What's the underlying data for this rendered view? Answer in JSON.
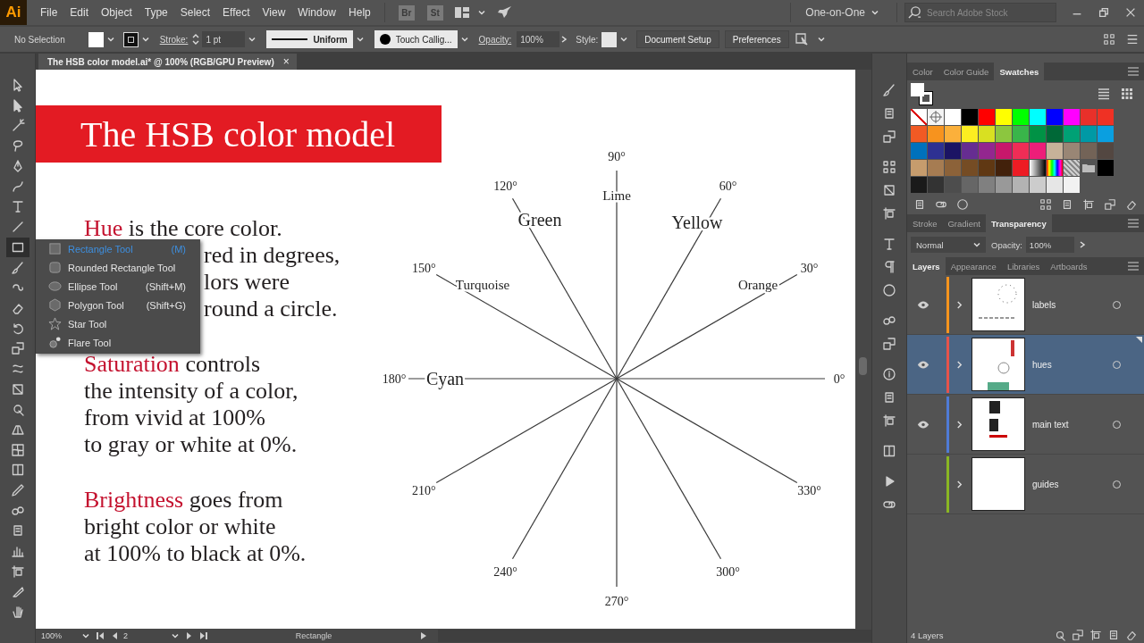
{
  "menu_bar": {
    "logo": "Ai",
    "items": [
      "File",
      "Edit",
      "Object",
      "Type",
      "Select",
      "Effect",
      "View",
      "Window",
      "Help"
    ],
    "bridge": "Br",
    "stock": "St",
    "workspace": "One-on-One",
    "search": {
      "placeholder": "Search Adobe Stock"
    }
  },
  "control_bar": {
    "selection": "No Selection",
    "stroke_label": "Stroke:",
    "stroke_weight": "1 pt",
    "profile": "Uniform",
    "brush": "Touch Callig...",
    "opacity_label": "Opacity:",
    "opacity": "100%",
    "style_label": "Style:",
    "buttons": [
      "Document Setup",
      "Preferences"
    ]
  },
  "document_tab": {
    "title": "The HSB color model.ai* @ 100% (RGB/GPU Preview)",
    "close": "×"
  },
  "tools": [
    {
      "kind": "arrow",
      "selected": false
    },
    {
      "kind": "direct",
      "selected": false
    },
    {
      "kind": "wand",
      "selected": false
    },
    {
      "kind": "lasso",
      "selected": false
    },
    {
      "kind": "pen",
      "selected": false
    },
    {
      "kind": "curve",
      "selected": false
    },
    {
      "kind": "type",
      "selected": false
    },
    {
      "kind": "line",
      "selected": false
    },
    {
      "kind": "rect",
      "selected": true
    },
    {
      "kind": "brush",
      "selected": false
    },
    {
      "kind": "shaper",
      "selected": false
    },
    {
      "kind": "eraser",
      "selected": false
    },
    {
      "kind": "rotate",
      "selected": false
    },
    {
      "kind": "scale",
      "selected": false
    },
    {
      "kind": "warp",
      "selected": false
    },
    {
      "kind": "transform",
      "selected": false
    },
    {
      "kind": "builder",
      "selected": false
    },
    {
      "kind": "perspective",
      "selected": false
    },
    {
      "kind": "mesh",
      "selected": false
    },
    {
      "kind": "gradient",
      "selected": false
    },
    {
      "kind": "eyedropper",
      "selected": false
    },
    {
      "kind": "blend",
      "selected": false
    },
    {
      "kind": "symbol",
      "selected": false
    },
    {
      "kind": "graph",
      "selected": false
    },
    {
      "kind": "artboard",
      "selected": false
    },
    {
      "kind": "knife",
      "selected": false
    },
    {
      "kind": "hand",
      "selected": false
    }
  ],
  "tool_flyout": {
    "items": [
      {
        "kind": "rectangle",
        "label": "Rectangle Tool",
        "shortcut": "(M)",
        "selected": true
      },
      {
        "kind": "rounded",
        "label": "Rounded Rectangle Tool",
        "selected": false
      },
      {
        "kind": "ellipse",
        "label": "Ellipse Tool",
        "shortcut": "(Shift+M)",
        "selected": false
      },
      {
        "kind": "polygon",
        "label": "Polygon Tool",
        "shortcut": "(Shift+G)",
        "selected": false
      },
      {
        "kind": "star",
        "label": "Star Tool",
        "selected": false
      },
      {
        "kind": "flare",
        "label": "Flare Tool",
        "selected": false
      }
    ]
  },
  "artboard": {
    "title": "The HSB color model",
    "paragraphs": [
      {
        "term": "Hue",
        "lines": [
          {
            "text": "is the core color.",
            "covered": false
          },
          {
            "text": "red in degrees,",
            "covered": true
          },
          {
            "text": "lors were",
            "covered": true
          },
          {
            "text": "round a circle.",
            "covered": true
          }
        ]
      },
      {
        "term": "Saturation",
        "lines": [
          {
            "text": "controls"
          },
          {
            "text": "the intensity of a color,"
          },
          {
            "text": "from vivid at 100%"
          },
          {
            "text": "to gray or white at 0%."
          }
        ]
      },
      {
        "term": "Brightness",
        "lines": [
          {
            "text": "goes from"
          },
          {
            "text": "bright color or white"
          },
          {
            "text": "at 100% to black at 0%."
          }
        ]
      }
    ],
    "angles": [
      "0°",
      "30°",
      "60°",
      "90°",
      "120°",
      "150°",
      "180°",
      "210°",
      "240°",
      "270°",
      "300°",
      "330°"
    ],
    "hues": [
      "Orange",
      "Yellow",
      "Lime",
      "Green",
      "Turquoise",
      "Cyan"
    ]
  },
  "status_bar": {
    "zoom": "100%",
    "artboard": "2",
    "tool": "Rectangle"
  },
  "swatches_panel": {
    "tabs": [
      {
        "label": "Color",
        "selected": false
      },
      {
        "label": "Color Guide",
        "selected": false
      },
      {
        "label": "Swatches",
        "selected": true
      }
    ],
    "swatches": [
      {
        "kind": "none"
      },
      {
        "kind": "registration"
      },
      {
        "kind": "color",
        "color": "#ffffff"
      },
      {
        "kind": "color",
        "color": "#000000"
      },
      {
        "kind": "color",
        "color": "#ff0000"
      },
      {
        "kind": "color",
        "color": "#ffff00"
      },
      {
        "kind": "color",
        "color": "#00ff00"
      },
      {
        "kind": "color",
        "color": "#00ffff"
      },
      {
        "kind": "color",
        "color": "#0000ff"
      },
      {
        "kind": "color",
        "color": "#ff00ff"
      },
      {
        "kind": "color",
        "color": "#e8302a"
      },
      {
        "kind": "color",
        "color": "#ef3124"
      },
      {
        "kind": "color",
        "color": "#f15a24"
      },
      {
        "kind": "color",
        "color": "#f7931e"
      },
      {
        "kind": "color",
        "color": "#fbb03b"
      },
      {
        "kind": "color",
        "color": "#fcee21"
      },
      {
        "kind": "color",
        "color": "#d9e021"
      },
      {
        "kind": "color",
        "color": "#8cc63f"
      },
      {
        "kind": "color",
        "color": "#39b54a"
      },
      {
        "kind": "color",
        "color": "#009245"
      },
      {
        "kind": "color",
        "color": "#006837"
      },
      {
        "kind": "color",
        "color": "#00a175"
      },
      {
        "kind": "color",
        "color": "#0099a5"
      },
      {
        "kind": "color",
        "color": "#0a9fe0"
      },
      {
        "kind": "color",
        "color": "#0071bc"
      },
      {
        "kind": "color",
        "color": "#2e3192"
      },
      {
        "kind": "color",
        "color": "#1b1464"
      },
      {
        "kind": "color",
        "color": "#662d91"
      },
      {
        "kind": "color",
        "color": "#93278f"
      },
      {
        "kind": "color",
        "color": "#c8176b"
      },
      {
        "kind": "color",
        "color": "#ef2d56"
      },
      {
        "kind": "color",
        "color": "#ed1e79"
      },
      {
        "kind": "color",
        "color": "#c7b299"
      },
      {
        "kind": "color",
        "color": "#998675"
      },
      {
        "kind": "color",
        "color": "#736357"
      },
      {
        "kind": "color",
        "color": "#534741"
      },
      {
        "kind": "color",
        "color": "#c69c6d"
      },
      {
        "kind": "color",
        "color": "#a67c52"
      },
      {
        "kind": "color",
        "color": "#8c6239"
      },
      {
        "kind": "color",
        "color": "#754c24"
      },
      {
        "kind": "color",
        "color": "#603813"
      },
      {
        "kind": "color",
        "color": "#42210b"
      },
      {
        "kind": "color",
        "color": "#ed1c24"
      },
      {
        "kind": "gradient"
      },
      {
        "kind": "spectrum"
      },
      {
        "kind": "pattern"
      },
      {
        "kind": "folder"
      },
      {
        "kind": "color",
        "color": "#000000"
      },
      {
        "kind": "color",
        "color": "#1a1a1a"
      },
      {
        "kind": "color",
        "color": "#333333"
      },
      {
        "kind": "color",
        "color": "#4d4d4d"
      },
      {
        "kind": "color",
        "color": "#666666"
      },
      {
        "kind": "color",
        "color": "#808080"
      },
      {
        "kind": "color",
        "color": "#999999"
      },
      {
        "kind": "color",
        "color": "#b3b3b3"
      },
      {
        "kind": "color",
        "color": "#cccccc"
      },
      {
        "kind": "color",
        "color": "#e6e6e6"
      },
      {
        "kind": "color",
        "color": "#f2f2f2"
      }
    ]
  },
  "transparency_panel": {
    "tabs": [
      {
        "label": "Stroke",
        "selected": false
      },
      {
        "label": "Gradient",
        "selected": false
      },
      {
        "label": "Transparency",
        "selected": true
      }
    ],
    "blend_mode": "Normal",
    "opacity_label": "Opacity:",
    "opacity": "100%"
  },
  "layers_panel": {
    "tabs": [
      {
        "label": "Layers",
        "selected": true
      },
      {
        "label": "Appearance",
        "selected": false
      },
      {
        "label": "Libraries",
        "selected": false
      },
      {
        "label": "Artboards",
        "selected": false
      }
    ],
    "layers": [
      {
        "name": "labels",
        "color": "#f7941d",
        "visible": true,
        "selected": false
      },
      {
        "name": "hues",
        "color": "#e5534b",
        "visible": true,
        "selected": true
      },
      {
        "name": "main text",
        "color": "#4f7bd6",
        "visible": true,
        "selected": false
      },
      {
        "name": "guides",
        "color": "#8ab623",
        "visible": false,
        "selected": false
      }
    ],
    "count": "4 Layers"
  }
}
